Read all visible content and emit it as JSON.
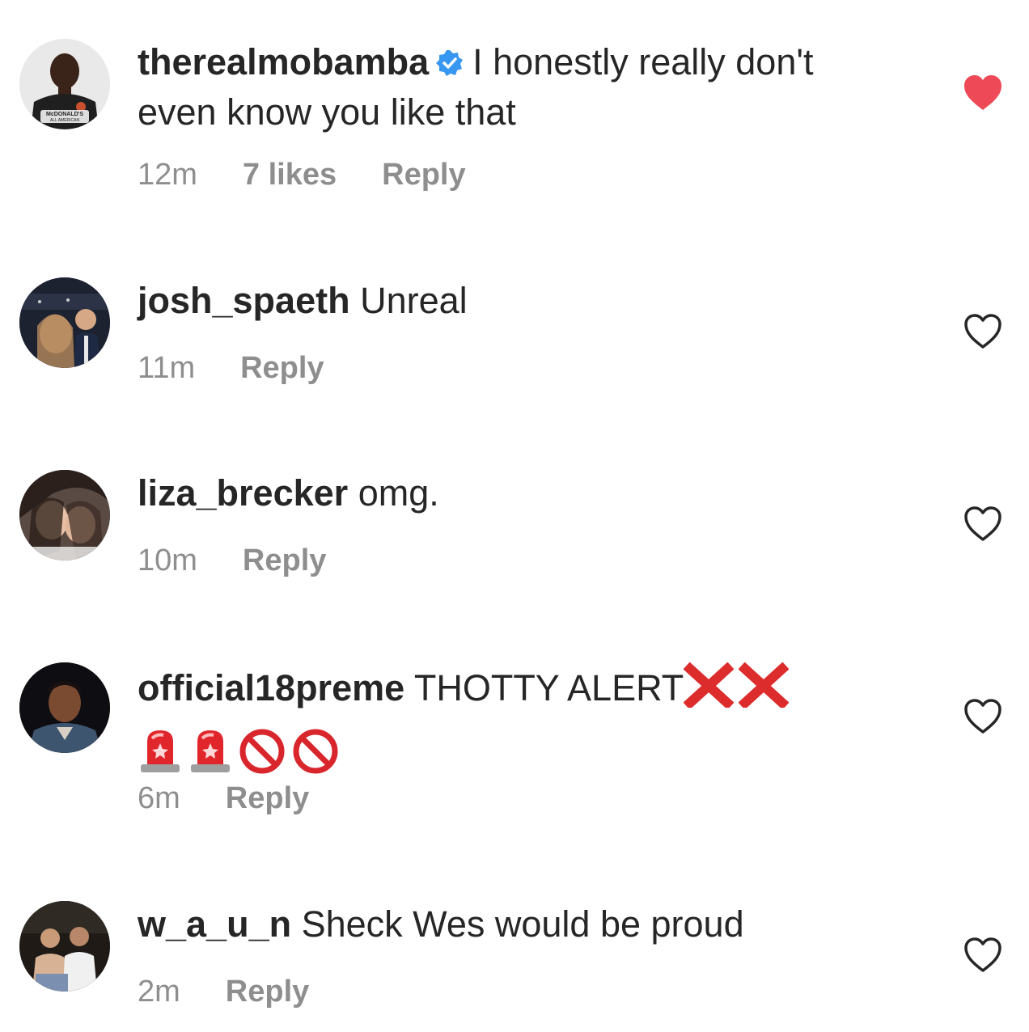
{
  "comments": [
    {
      "username": "therealmobamba",
      "verified": true,
      "text": "I honestly really don't even know you like that",
      "time": "12m",
      "likes": "7 likes",
      "reply_label": "Reply",
      "liked": true,
      "avatar_badge_line1": "McDONALD'S",
      "avatar_badge_line2": "ALL AMERICAN"
    },
    {
      "username": "josh_spaeth",
      "text": "Unreal",
      "time": "11m",
      "reply_label": "Reply",
      "liked": false
    },
    {
      "username": "liza_brecker",
      "text": "omg.",
      "time": "10m",
      "reply_label": "Reply",
      "liked": false
    },
    {
      "username": "official18preme",
      "text": "THOTTY ALERT",
      "emojis": [
        "cross-mark-icon",
        "cross-mark-icon",
        "police-light-icon",
        "police-light-icon",
        "no-entry-icon",
        "no-entry-icon"
      ],
      "time": "6m",
      "reply_label": "Reply",
      "liked": false
    },
    {
      "username": "w_a_u_n",
      "text": "Sheck Wes would be proud",
      "time": "2m",
      "reply_label": "Reply",
      "liked": false
    }
  ],
  "colors": {
    "text": "#262626",
    "meta": "#8e8e8e",
    "liked_heart": "#ed4956",
    "verified": "#3897f0"
  }
}
